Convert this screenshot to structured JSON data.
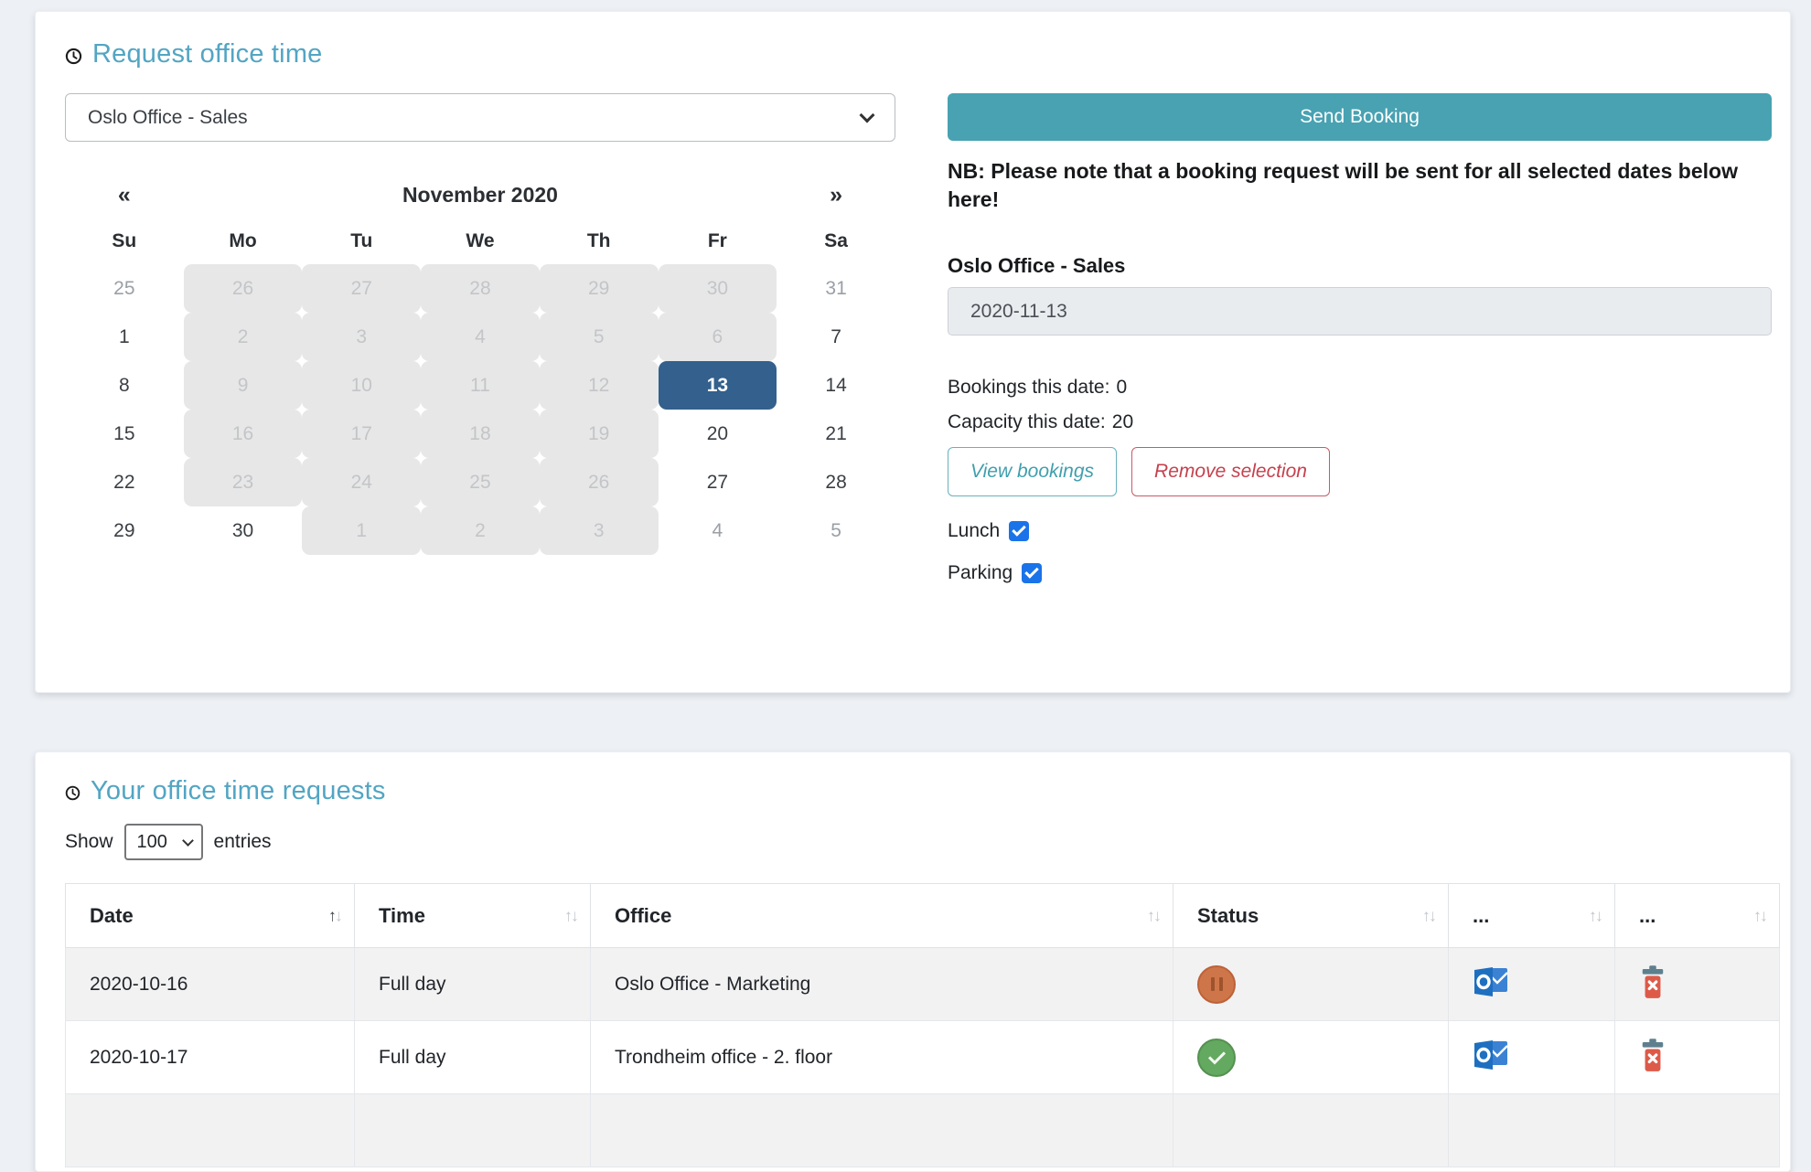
{
  "colors": {
    "title_teal": "#52a5c3",
    "button_teal": "#48a2b2",
    "selected_day_blue": "#33608c",
    "danger_red": "#c5414e",
    "checkbox_blue": "#1a73e8",
    "status_pending_orange": "#ce764a",
    "status_approved_green": "#63a95f"
  },
  "request_card": {
    "title": "Request office time",
    "office_select_value": "Oslo Office - Sales",
    "send_booking_label": "Send Booking",
    "nb_note": "NB: Please note that a booking request will be sent for all selected dates below here!",
    "selected_office_label": "Oslo Office - Sales",
    "date_value": "2020-11-13",
    "bookings_label": "Bookings this date:",
    "bookings_value": "0",
    "capacity_label": "Capacity this date:",
    "capacity_value": "20",
    "view_bookings_label": "View bookings",
    "remove_selection_label": "Remove selection",
    "lunch_label": "Lunch",
    "lunch_checked": true,
    "parking_label": "Parking",
    "parking_checked": true,
    "calendar": {
      "prev_arrow": "«",
      "next_arrow": "»",
      "month_title": "November 2020",
      "day_headers": [
        "Su",
        "Mo",
        "Tu",
        "We",
        "Th",
        "Fr",
        "Sa"
      ],
      "weeks": [
        [
          {
            "d": "25",
            "state": "muted"
          },
          {
            "d": "26",
            "state": "disabled"
          },
          {
            "d": "27",
            "state": "disabled"
          },
          {
            "d": "28",
            "state": "disabled"
          },
          {
            "d": "29",
            "state": "disabled"
          },
          {
            "d": "30",
            "state": "disabled"
          },
          {
            "d": "31",
            "state": "muted"
          }
        ],
        [
          {
            "d": "1",
            "state": "normal"
          },
          {
            "d": "2",
            "state": "disabled"
          },
          {
            "d": "3",
            "state": "disabled"
          },
          {
            "d": "4",
            "state": "disabled"
          },
          {
            "d": "5",
            "state": "disabled"
          },
          {
            "d": "6",
            "state": "disabled"
          },
          {
            "d": "7",
            "state": "normal"
          }
        ],
        [
          {
            "d": "8",
            "state": "normal"
          },
          {
            "d": "9",
            "state": "disabled"
          },
          {
            "d": "10",
            "state": "disabled"
          },
          {
            "d": "11",
            "state": "disabled"
          },
          {
            "d": "12",
            "state": "disabled"
          },
          {
            "d": "13",
            "state": "selected"
          },
          {
            "d": "14",
            "state": "normal"
          }
        ],
        [
          {
            "d": "15",
            "state": "normal"
          },
          {
            "d": "16",
            "state": "disabled"
          },
          {
            "d": "17",
            "state": "disabled"
          },
          {
            "d": "18",
            "state": "disabled"
          },
          {
            "d": "19",
            "state": "disabled"
          },
          {
            "d": "20",
            "state": "normal"
          },
          {
            "d": "21",
            "state": "normal"
          }
        ],
        [
          {
            "d": "22",
            "state": "normal"
          },
          {
            "d": "23",
            "state": "disabled"
          },
          {
            "d": "24",
            "state": "disabled"
          },
          {
            "d": "25",
            "state": "disabled"
          },
          {
            "d": "26",
            "state": "disabled"
          },
          {
            "d": "27",
            "state": "normal"
          },
          {
            "d": "28",
            "state": "normal"
          }
        ],
        [
          {
            "d": "29",
            "state": "normal"
          },
          {
            "d": "30",
            "state": "normal"
          },
          {
            "d": "1",
            "state": "disabled"
          },
          {
            "d": "2",
            "state": "disabled"
          },
          {
            "d": "3",
            "state": "disabled"
          },
          {
            "d": "4",
            "state": "muted"
          },
          {
            "d": "5",
            "state": "muted"
          }
        ]
      ]
    }
  },
  "requests_card": {
    "title": "Your office time requests",
    "show_label": "Show",
    "entries_per_page": "100",
    "entries_label": "entries",
    "sort_up": "↑",
    "sort_down": "↓",
    "table": {
      "columns": [
        {
          "label": "Date",
          "sorted": "asc"
        },
        {
          "label": "Time",
          "sorted": "none"
        },
        {
          "label": "Office",
          "sorted": "none"
        },
        {
          "label": "Status",
          "sorted": "none"
        },
        {
          "label": "...",
          "sorted": "none"
        },
        {
          "label": "...",
          "sorted": "none"
        }
      ],
      "rows": [
        {
          "date": "2020-10-16",
          "time": "Full day",
          "office": "Oslo Office - Marketing",
          "status": "pending",
          "actions": [
            "outlook-email",
            "delete"
          ]
        },
        {
          "date": "2020-10-17",
          "time": "Full day",
          "office": "Trondheim office - 2. floor",
          "status": "approved",
          "actions": [
            "outlook-email",
            "delete"
          ]
        }
      ]
    }
  }
}
